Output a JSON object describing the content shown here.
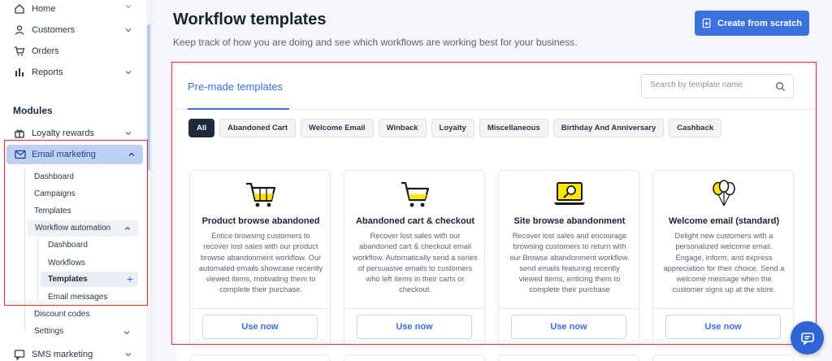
{
  "sidebar": {
    "top_items": [
      {
        "label": "Home",
        "icon": "home-icon"
      },
      {
        "label": "Customers",
        "icon": "users-icon"
      },
      {
        "label": "Orders",
        "icon": "cart-icon"
      },
      {
        "label": "Reports",
        "icon": "bar-chart-icon"
      }
    ],
    "modules_label": "Modules",
    "loyalty_label": "Loyalty rewards",
    "email_marketing_label": "Email marketing",
    "email_sub": {
      "dashboard": "Dashboard",
      "campaigns": "Campaigns",
      "templates": "Templates",
      "workflow_automation": "Workflow automation",
      "wf_dashboard": "Dashboard",
      "wf_workflows": "Workflows",
      "wf_templates": "Templates",
      "wf_email_messages": "Email messages",
      "discount_codes": "Discount codes",
      "settings": "Settings"
    },
    "sms_label": "SMS marketing"
  },
  "header": {
    "title": "Workflow templates",
    "subtitle": "Keep track of how you are doing and see which workflows are working best for your business.",
    "create_button": "Create from scratch"
  },
  "panel": {
    "tab_label": "Pre-made templates",
    "search_placeholder": "Search by template name",
    "chips": [
      "All",
      "Abandoned Cart",
      "Welcome Email",
      "Winback",
      "Loyalty",
      "Miscellaneous",
      "Birthday And Anniversary",
      "Cashback"
    ],
    "cards": [
      {
        "title": "Product browse abandoned",
        "desc": "Entice browsing customers to recover lost sales with our product browse abandonment workflow. Our automated emails showcase recently viewed items, motivating them to complete their purchase.",
        "button": "Use now",
        "icon": "cart-icon"
      },
      {
        "title": "Abandoned cart & checkout",
        "desc": "Recover lost sales with our abandoned cart & checkout email workflow. Automatically send a series of persuasive emails to customers who left items in their carts or checkout.",
        "button": "Use now",
        "icon": "cart-icon"
      },
      {
        "title": "Site browse abandonment",
        "desc": "Recover lost sales and encourage browsing customers to return with our Browse abandonment workflow. send emails featuring recently viewed items, enticing them to complete their purchase",
        "button": "Use now",
        "icon": "laptop-search-icon"
      },
      {
        "title": "Welcome email (standard)",
        "desc": "Delight new customers with a personalized welcome email. Engage, inform, and express appreciation for their choice. Send a welcome message when the customer signs up at the store.",
        "button": "Use now",
        "icon": "balloons-icon"
      }
    ]
  },
  "colors": {
    "accent": "#3b72e0",
    "highlight_box": "#e0282e",
    "illustration_yellow": "#ffe600"
  }
}
